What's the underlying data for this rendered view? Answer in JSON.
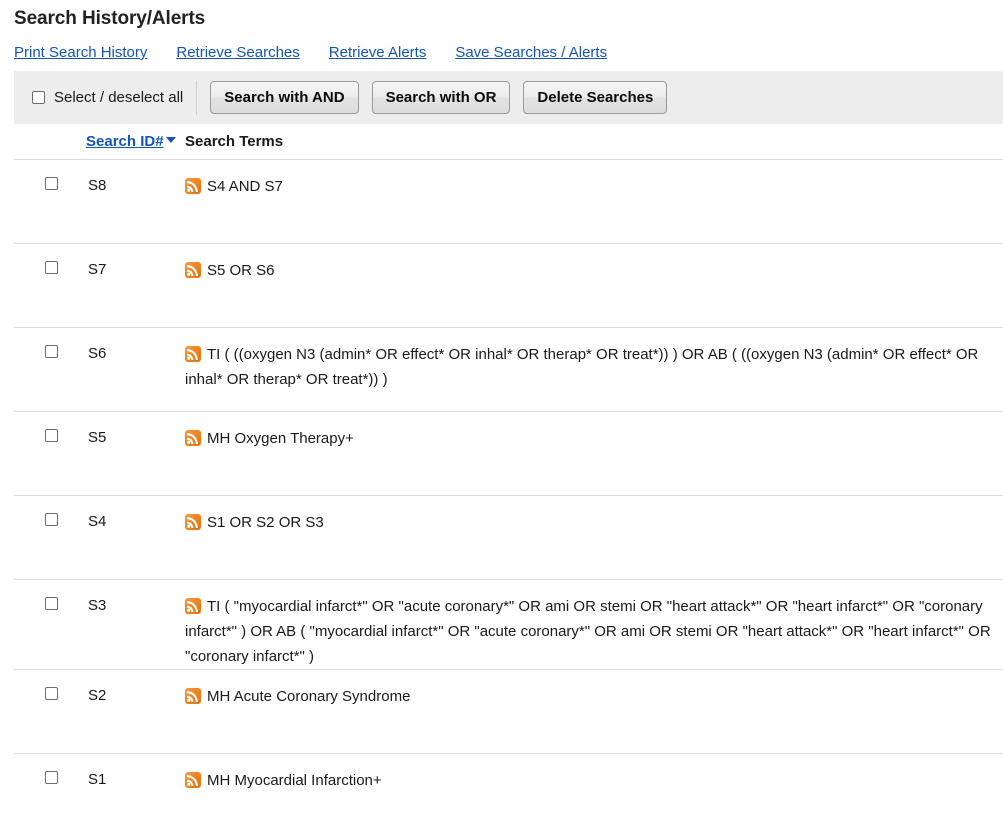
{
  "page": {
    "title": "Search History/Alerts"
  },
  "action_links": [
    {
      "label": "Print Search History",
      "name": "print-search-history-link"
    },
    {
      "label": "Retrieve Searches",
      "name": "retrieve-searches-link"
    },
    {
      "label": "Retrieve Alerts",
      "name": "retrieve-alerts-link"
    },
    {
      "label": "Save Searches / Alerts",
      "name": "save-searches-alerts-link"
    }
  ],
  "toolbar": {
    "select_all_label": "Select / deselect all",
    "search_and_label": "Search with AND",
    "search_or_label": "Search with OR",
    "delete_label": "Delete Searches"
  },
  "table": {
    "headers": {
      "search_id": "Search ID#",
      "search_terms": "Search Terms"
    },
    "sort": {
      "column": "Search ID#",
      "direction": "descending",
      "icon": "caret-down-icon"
    },
    "rows": [
      {
        "id": "S8",
        "terms": "S4 AND S7",
        "icon": "rss-alert-icon",
        "checked": false
      },
      {
        "id": "S7",
        "terms": "S5 OR S6",
        "icon": "rss-alert-icon",
        "checked": false
      },
      {
        "id": "S6",
        "terms": "TI ( ((oxygen N3 (admin* OR effect* OR inhal* OR therap* OR treat*)) ) OR AB ( ((oxygen N3 (admin* OR effect* OR inhal* OR therap* OR treat*)) )",
        "icon": "rss-alert-icon",
        "checked": false
      },
      {
        "id": "S5",
        "terms": "MH Oxygen Therapy+",
        "icon": "rss-alert-icon",
        "checked": false
      },
      {
        "id": "S4",
        "terms": "S1 OR S2 OR S3",
        "icon": "rss-alert-icon",
        "checked": false
      },
      {
        "id": "S3",
        "terms": "TI ( \"myocardial infarct*\" OR \"acute coronary*\" OR ami OR stemi OR \"heart attack*\" OR \"heart infarct*\" OR \"coronary infarct*\" ) OR AB ( \"myocardial infarct*\" OR \"acute coronary*\" OR ami OR stemi OR \"heart attack*\" OR \"heart infarct*\" OR \"coronary infarct*\" )",
        "icon": "rss-alert-icon",
        "checked": false
      },
      {
        "id": "S2",
        "terms": "MH Acute Coronary Syndrome",
        "icon": "rss-alert-icon",
        "checked": false
      },
      {
        "id": "S1",
        "terms": "MH Myocardial Infarction+",
        "icon": "rss-alert-icon",
        "checked": false
      }
    ]
  },
  "colors": {
    "link": "#1455b8",
    "toolbar_background": "#ededed",
    "rss_orange": "#ef8422",
    "row_divider": "#dcdcdc"
  }
}
